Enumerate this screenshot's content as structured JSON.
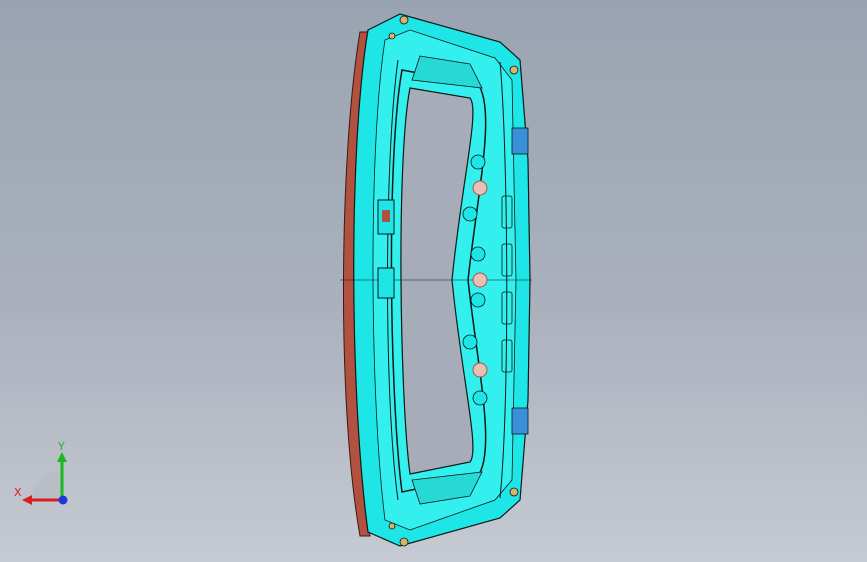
{
  "viewport": {
    "background_top": "#9aa3b1",
    "background_bottom": "#c6cad2"
  },
  "model": {
    "part_color": "#1fe6e6",
    "edge_color": "#0b1a1a",
    "flange_color": "#b0523f",
    "bracket_color": "#3a8fd9"
  },
  "triad": {
    "x_label": "X",
    "y_label": "Y",
    "x_color": "#d81e1e",
    "y_color": "#19b81e",
    "z_color": "#1d37d8"
  }
}
